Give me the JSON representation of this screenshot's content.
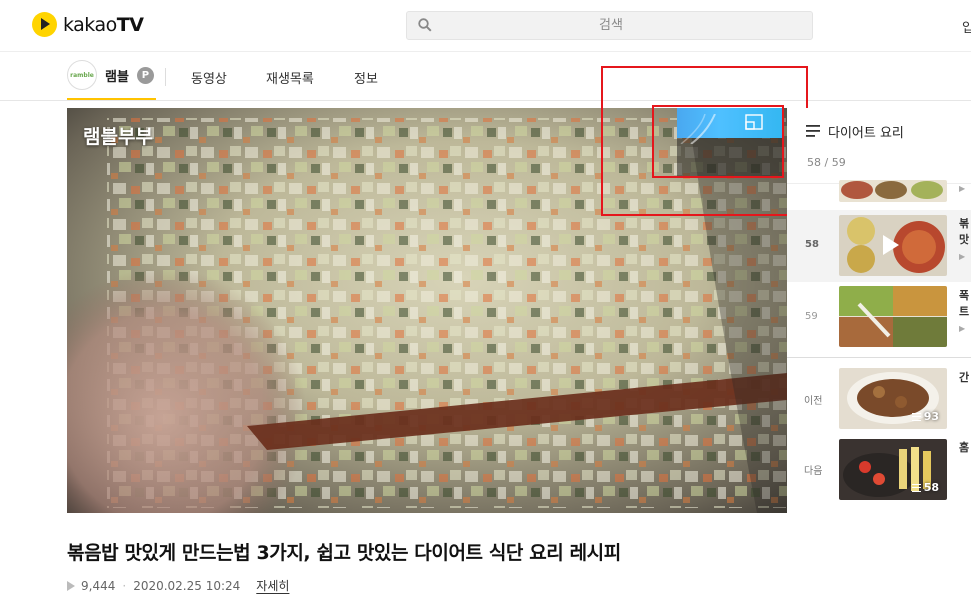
{
  "header": {
    "logo_text_light": "kakao",
    "logo_text_bold": "TV",
    "search_placeholder": "검색",
    "login_label": "입"
  },
  "channel": {
    "avatar_label": "ramble",
    "name": "램블",
    "badge": "P",
    "tabs": [
      "동영상",
      "재생목록",
      "정보"
    ]
  },
  "video": {
    "watermark": "램블부부"
  },
  "playlist": {
    "title": "다이어트 요리",
    "count": "58 / 59",
    "items": [
      {
        "num": "58",
        "text_line1": "볶",
        "text_line2": "맛",
        "active": true
      },
      {
        "num": "59",
        "text_line1": "폭",
        "text_line2": "트",
        "active": false
      }
    ],
    "prev": {
      "label": "이전",
      "text": "간",
      "count": "93"
    },
    "next": {
      "label": "다음",
      "text": "홈",
      "count": "58"
    }
  },
  "info": {
    "title": "볶음밥 맛있게 만드는법 3가지, 쉽고 맛있는 다이어트 식단 요리 레시피",
    "views": "9,444",
    "date": "2020.02.25 10:24",
    "details_label": "자세히"
  },
  "colors": {
    "accent_yellow": "#ffc300",
    "annotation_red": "#e5161c",
    "pip_blue": "#4fc0ff"
  },
  "icons": [
    "kakao-play-logo-icon",
    "search-icon",
    "menu-lines-icon",
    "pip-icon",
    "play-icon",
    "playlist-count-icon"
  ]
}
